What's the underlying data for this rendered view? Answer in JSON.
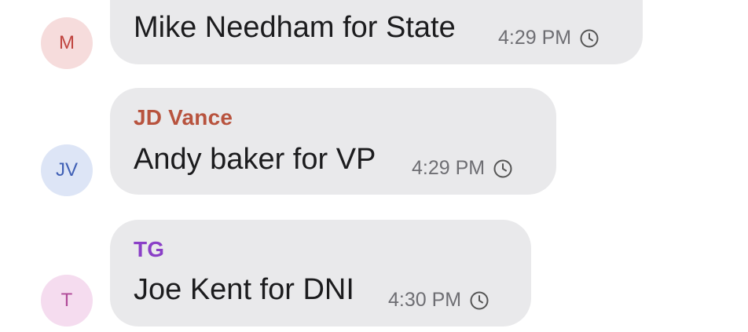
{
  "messages": [
    {
      "avatar_initials": "M",
      "sender": "",
      "text": "Mike Needham for State",
      "time": "4:29 PM",
      "status_icon": "clock-icon",
      "avatar_bg": "#f6dcdc",
      "avatar_color": "#c0443f",
      "sender_color": ""
    },
    {
      "avatar_initials": "JV",
      "sender": "JD Vance",
      "text": "Andy baker for VP",
      "time": "4:29 PM",
      "status_icon": "clock-icon",
      "avatar_bg": "#dde5f6",
      "avatar_color": "#3f5fb5",
      "sender_color": "#b8533e"
    },
    {
      "avatar_initials": "T",
      "sender": "TG",
      "text": "Joe Kent for DNI",
      "time": "4:30 PM",
      "status_icon": "clock-icon",
      "avatar_bg": "#f5dcef",
      "avatar_color": "#b04a98",
      "sender_color": "#8a3fc7"
    }
  ]
}
